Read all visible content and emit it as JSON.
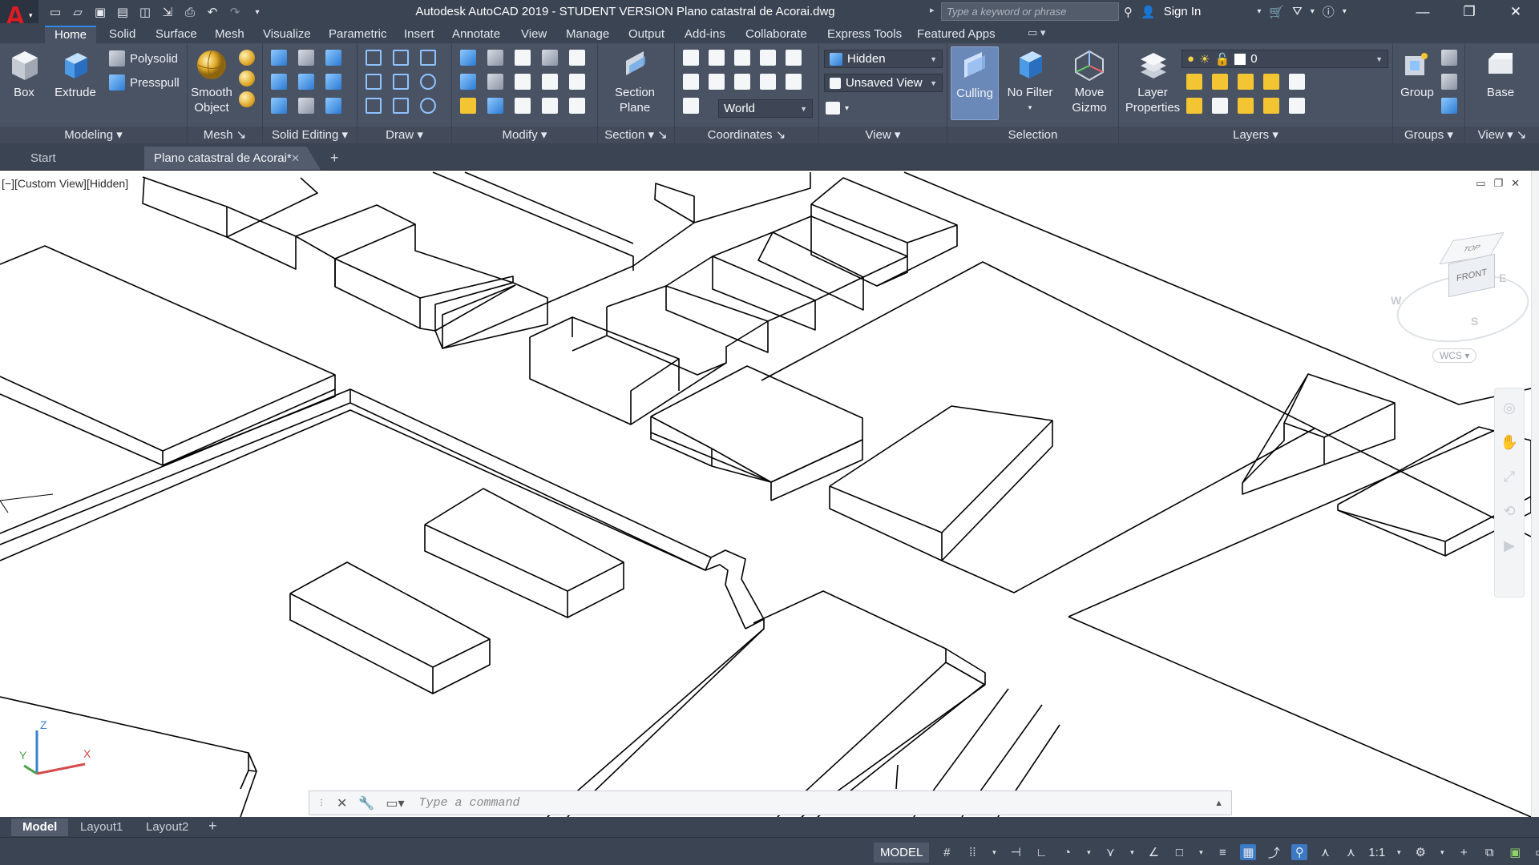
{
  "titlebar": {
    "title": "Autodesk AutoCAD 2019 - STUDENT VERSION    Plano catastral de Acorai.dwg",
    "search_placeholder": "Type a keyword or phrase",
    "signin_label": "Sign In",
    "app_letter": "A"
  },
  "ribbon_tabs": [
    "Home",
    "Solid",
    "Surface",
    "Mesh",
    "Visualize",
    "Parametric",
    "Insert",
    "Annotate",
    "View",
    "Manage",
    "Output",
    "Add-ins",
    "Collaborate",
    "Express Tools",
    "Featured Apps"
  ],
  "ribbon": {
    "modeling": {
      "title": "Modeling",
      "box": "Box",
      "extrude": "Extrude",
      "polysolid": "Polysolid",
      "presspull": "Presspull"
    },
    "mesh": {
      "title": "Mesh",
      "smooth_line1": "Smooth",
      "smooth_line2": "Object"
    },
    "solid_editing": {
      "title": "Solid Editing"
    },
    "draw": {
      "title": "Draw"
    },
    "modify": {
      "title": "Modify"
    },
    "section": {
      "title": "Section",
      "plane_line1": "Section",
      "plane_line2": "Plane"
    },
    "coordinates": {
      "title": "Coordinates",
      "ucs_combo": "World"
    },
    "view": {
      "title": "View",
      "visual_style": "Hidden",
      "named_view": "Unsaved View"
    },
    "selection": {
      "title": "Selection",
      "culling": "Culling",
      "nofilter_line1": "No Filter",
      "gizmo_line1": "Move",
      "gizmo_line2": "Gizmo"
    },
    "layers": {
      "title": "Layers",
      "props_line1": "Layer",
      "props_line2": "Properties",
      "current_layer": "0"
    },
    "groups": {
      "title": "Groups",
      "group": "Group"
    },
    "viewpanel2": {
      "title": "View",
      "base": "Base"
    }
  },
  "file_tabs": {
    "start": "Start",
    "doc": "Plano catastral de Acorai*"
  },
  "viewport": {
    "label": "[−][Custom View][Hidden]",
    "viewcube": {
      "top": "TOP",
      "front": "FRONT",
      "w": "W",
      "e": "E",
      "s": "S",
      "wcs": "WCS"
    }
  },
  "ucs": {
    "x": "X",
    "y": "Y",
    "z": "Z"
  },
  "command": {
    "placeholder": "Type a command"
  },
  "layout_tabs": [
    "Model",
    "Layout1",
    "Layout2"
  ],
  "status": {
    "model": "MODEL",
    "scale": "1:1"
  },
  "colors": {
    "accent": "#2e8ae6",
    "ui_dark": "#3b4453",
    "ribbon": "#4a5364",
    "logo_red": "#e01b22"
  }
}
